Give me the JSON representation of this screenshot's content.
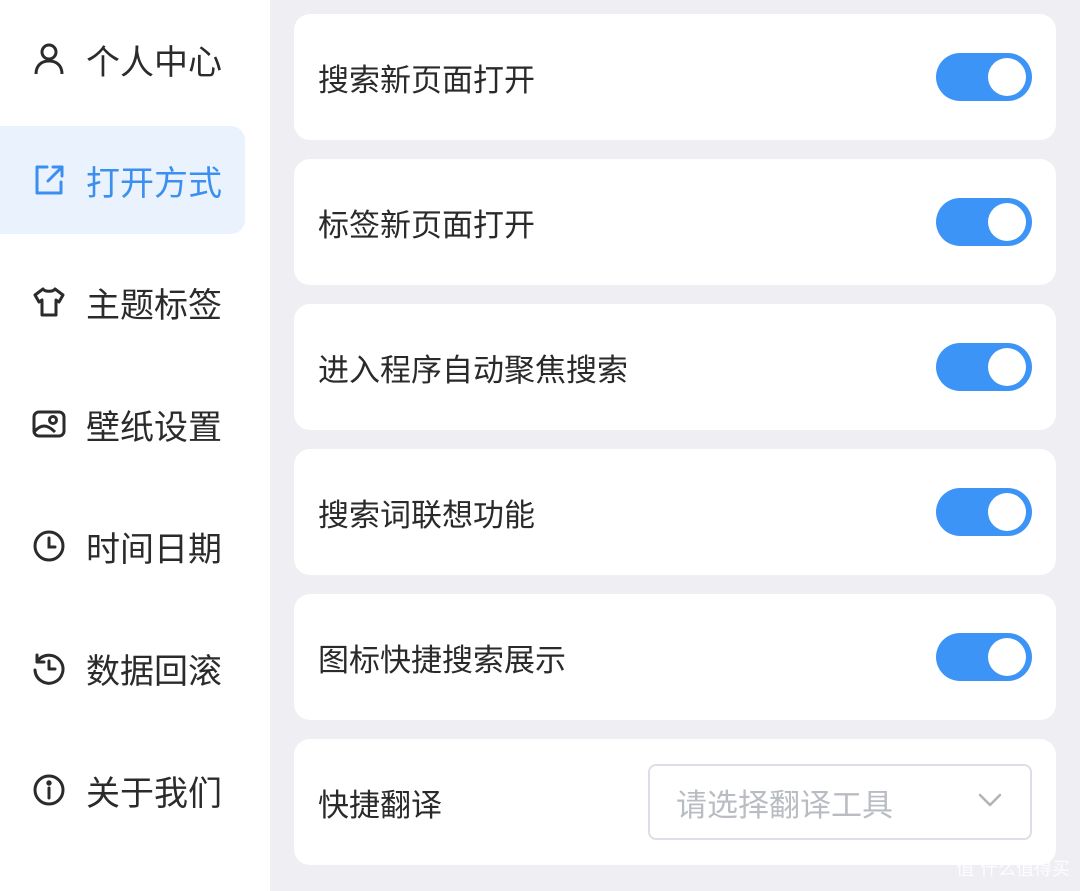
{
  "sidebar": {
    "items": [
      {
        "label": "个人中心",
        "icon": "user-icon",
        "active": false
      },
      {
        "label": "打开方式",
        "icon": "external-link-icon",
        "active": true
      },
      {
        "label": "主题标签",
        "icon": "shirt-icon",
        "active": false
      },
      {
        "label": "壁纸设置",
        "icon": "wallpaper-icon",
        "active": false
      },
      {
        "label": "时间日期",
        "icon": "clock-icon",
        "active": false
      },
      {
        "label": "数据回滚",
        "icon": "history-icon",
        "active": false
      },
      {
        "label": "关于我们",
        "icon": "info-icon",
        "active": false
      }
    ]
  },
  "settings": [
    {
      "label": "搜索新页面打开",
      "type": "toggle",
      "enabled": true
    },
    {
      "label": "标签新页面打开",
      "type": "toggle",
      "enabled": true
    },
    {
      "label": "进入程序自动聚焦搜索",
      "type": "toggle",
      "enabled": true
    },
    {
      "label": "搜索词联想功能",
      "type": "toggle",
      "enabled": true
    },
    {
      "label": "图标快捷搜索展示",
      "type": "toggle",
      "enabled": true
    },
    {
      "label": "快捷翻译",
      "type": "select",
      "placeholder": "请选择翻译工具"
    }
  ],
  "colors": {
    "accent": "#3d94f7",
    "active_bg": "#eaf3fd",
    "main_bg": "#eeeef3"
  },
  "watermark": "值 什么值得买"
}
